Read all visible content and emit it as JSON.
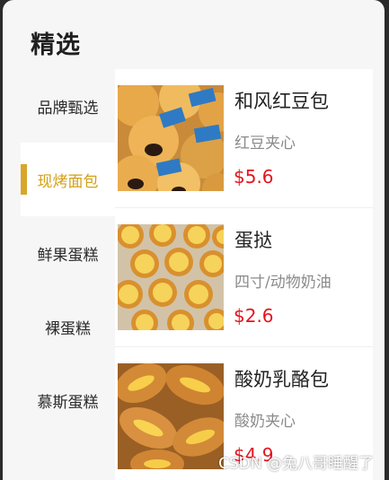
{
  "page": {
    "title": "精选"
  },
  "sidebar": {
    "items": [
      {
        "label": "品牌甄选",
        "active": false
      },
      {
        "label": "现烤面包",
        "active": true
      },
      {
        "label": "鲜果蛋糕",
        "active": false
      },
      {
        "label": "裸蛋糕",
        "active": false
      },
      {
        "label": "慕斯蛋糕",
        "active": false
      }
    ]
  },
  "products": [
    {
      "name": "和风红豆包",
      "desc": "红豆夹心",
      "price": "$5.6",
      "image": "red-bean-bun-image"
    },
    {
      "name": "蛋挞",
      "desc": "四寸/动物奶油",
      "price": "$2.6",
      "image": "egg-tart-image"
    },
    {
      "name": "酸奶乳酪包",
      "desc": "酸奶夹心",
      "price": "$4.9",
      "image": "yogurt-cheese-bun-image"
    }
  ],
  "watermark": "CSDN @兔八哥睡醒了",
  "colors": {
    "accent": "#d8a729",
    "price": "#e4141e",
    "background": "#f6f6f7"
  }
}
